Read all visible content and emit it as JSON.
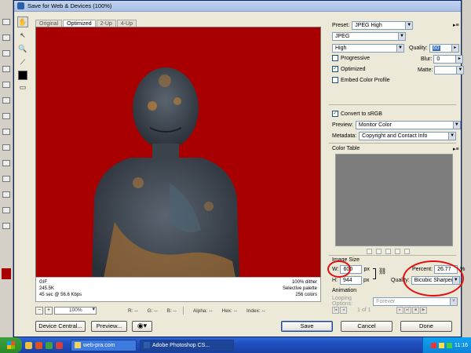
{
  "dialog": {
    "title": "Save for Web & Devices (100%)"
  },
  "tabs": [
    "Original",
    "Optimized",
    "2-Up",
    "4-Up"
  ],
  "preview": {
    "info_left": [
      "GIF",
      "245.5K",
      "45 sec @ 56.6 Kbps"
    ],
    "info_right": [
      "100% dither",
      "Selective palette",
      "256 colors"
    ]
  },
  "status": {
    "zoom": "100%",
    "r": "R: --",
    "g": "G: --",
    "b": "B: --",
    "alpha": "Alpha: --",
    "hex": "Hex: --",
    "index": "Index: --"
  },
  "buttons": {
    "device_central": "Device Central...",
    "preview": "Preview...",
    "save": "Save",
    "cancel": "Cancel",
    "done": "Done"
  },
  "settings": {
    "preset_label": "Preset:",
    "preset": "JPEG High",
    "format": "JPEG",
    "compression": "High",
    "quality_label": "Quality:",
    "quality": "60",
    "progressive": "Progressive",
    "blur_label": "Blur:",
    "blur": "0",
    "optimized": "Optimized",
    "matte_label": "Matte:",
    "matte": "",
    "embed_profile": "Embed Color Profile",
    "convert_srgb": "Convert to sRGB",
    "preview_label": "Preview:",
    "preview_mode": "Monitor Color",
    "metadata_label": "Metadata:",
    "metadata": "Copyright and Contact Info",
    "color_table": "Color Table"
  },
  "image_size": {
    "heading": "Image Size",
    "w_label": "W:",
    "w": "600",
    "h_label": "H:",
    "h": "944",
    "unit": "px",
    "percent_label": "Percent:",
    "percent": "26.77",
    "percent_unit": "%",
    "quality_label": "Quality:",
    "quality": "Bicubic Sharper"
  },
  "animation": {
    "heading": "Animation",
    "looping_label": "Looping Options:",
    "looping": "Forever",
    "frame": "1 of 1"
  },
  "taskbar": {
    "tasks": [
      "web-pra.com",
      "Adobe Photoshop CS..."
    ],
    "clock": "11:16"
  },
  "colors": {
    "matte_red": "#a80000",
    "highlight_oval": "#e01010"
  }
}
